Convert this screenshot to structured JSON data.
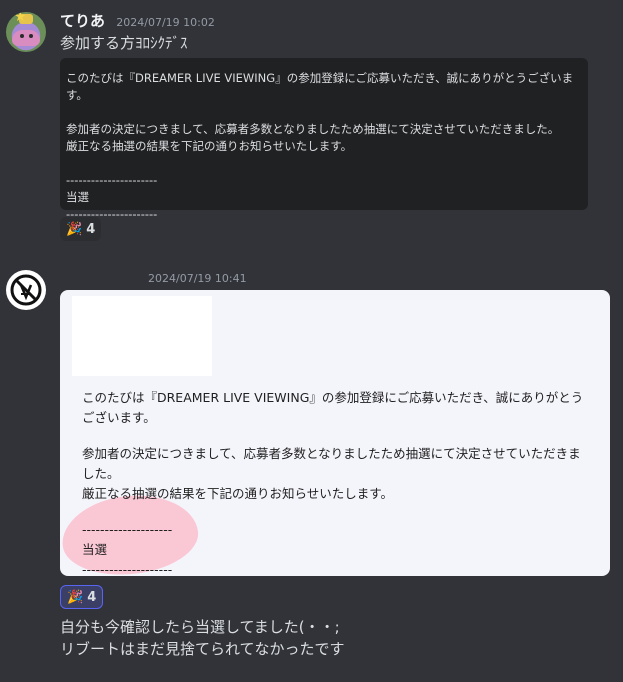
{
  "message1": {
    "username": "てりあ",
    "timestamp": "2024/07/19 10:02",
    "text": "参加する方ﾖﾛｼｸﾃﾞｽ",
    "embed": {
      "line1": "このたびは『DREAMER LIVE VIEWING』の参加登録にご応募いただき、誠にありがとうございます。",
      "line2a": "参加者の決定につきまして、応募者多数となりましたため抽選にて決定させていただきました。",
      "line2b": "厳正なる抽選の結果を下記の通りお知らせいたします。",
      "divider_top": "----------------------",
      "result": "当選",
      "divider_bottom": "----------------------"
    },
    "reaction": {
      "emoji": "🎉",
      "count": "4"
    }
  },
  "message2": {
    "timestamp": "2024/07/19 10:41",
    "embed": {
      "line1": "このたびは『DREAMER LIVE VIEWING』の参加登録にご応募いただき、誠にありがとうございます。",
      "line2": "参加者の決定につきまして、応募者多数となりましたため抽選にて決定させていただきました。",
      "line3": "厳正なる抽選の結果を下記の通りお知らせいたします。",
      "divider_top": "--------------------",
      "result": "当選",
      "divider_bottom": "--------------------"
    },
    "reaction": {
      "emoji": "🎉",
      "count": "4"
    },
    "text_line1": "自分も今確認したら当選してました(・・;",
    "text_line2": "リブートはまだ見捨てられてなかったです"
  },
  "colors": {
    "background": "#313338",
    "dark_embed": "#202122",
    "light_embed": "#f4f5fb",
    "reaction_active_border": "#5865f2",
    "highlight": "#ffa0b4"
  },
  "icons": {
    "avatar1": "cartoon-character-avatar",
    "avatar2": "circle-logo-avatar",
    "reaction": "party-popper-icon"
  }
}
